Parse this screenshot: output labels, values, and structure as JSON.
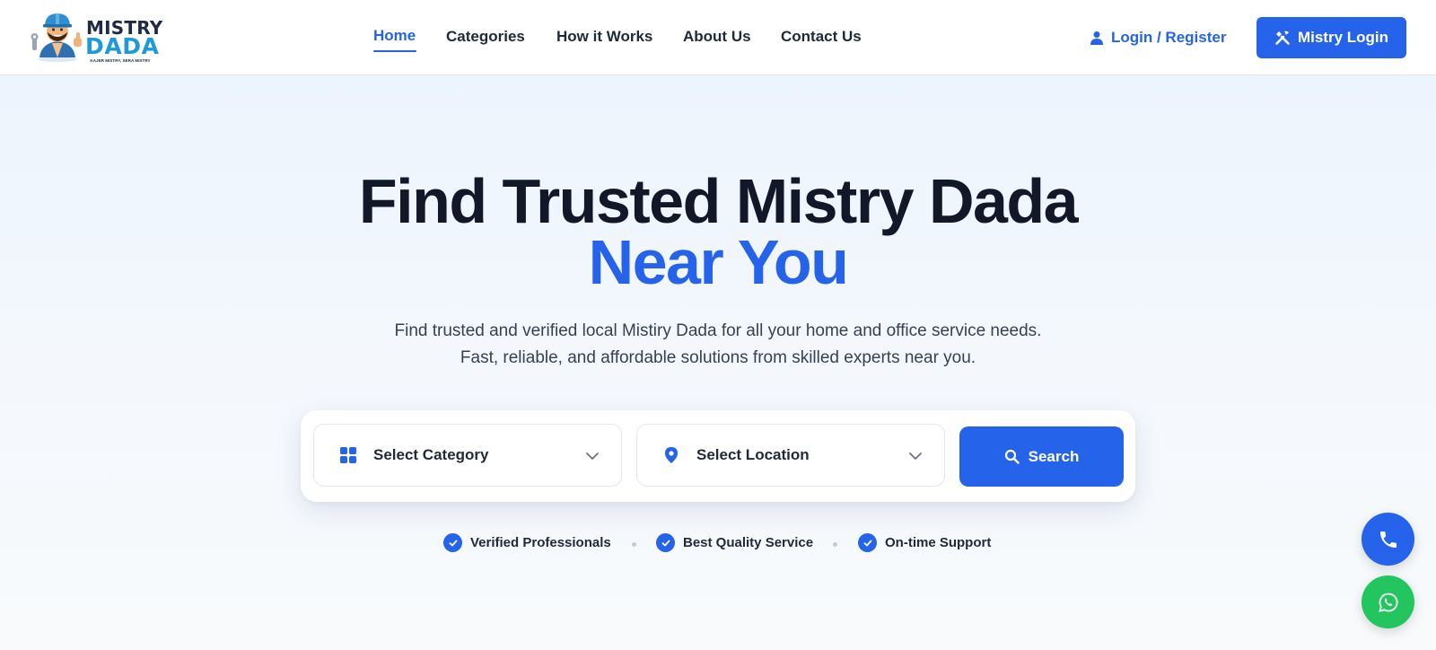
{
  "brand": {
    "name_line1": "MISTRY",
    "name_line2": "DADA",
    "tagline": "KAJER MISTRY, SERA MISTRY",
    "primary_color": "#2563eb",
    "logo_accent_color": "#1e9ad8"
  },
  "nav": {
    "items": [
      {
        "label": "Home",
        "active": true
      },
      {
        "label": "Categories",
        "active": false
      },
      {
        "label": "How it Works",
        "active": false
      },
      {
        "label": "About Us",
        "active": false
      },
      {
        "label": "Contact Us",
        "active": false
      }
    ],
    "login_register_label": "Login / Register",
    "login_register_icon": "user-icon",
    "mistry_login_label": "Mistry Login",
    "mistry_login_icon": "tools-icon"
  },
  "hero": {
    "title": "Find Trusted Mistry Dada",
    "title_accent": "Near You",
    "description_line1": "Find trusted and verified local Mistiry Dada for all your home and office service needs.",
    "description_line2": "Fast, reliable, and affordable solutions from skilled experts near you."
  },
  "search": {
    "category_label": "Select Category",
    "category_icon": "grid-icon",
    "location_label": "Select Location",
    "location_icon": "map-pin-icon",
    "button_label": "Search",
    "button_icon": "search-icon"
  },
  "badges": [
    {
      "label": "Verified Professionals",
      "icon": "check-circle-icon"
    },
    {
      "label": "Best Quality Service",
      "icon": "check-circle-icon"
    },
    {
      "label": "On-time Support",
      "icon": "check-circle-icon"
    }
  ],
  "floating": {
    "phone_icon": "phone-icon",
    "phone_color": "#2563eb",
    "whatsapp_icon": "whatsapp-icon",
    "whatsapp_color": "#22c55e"
  }
}
